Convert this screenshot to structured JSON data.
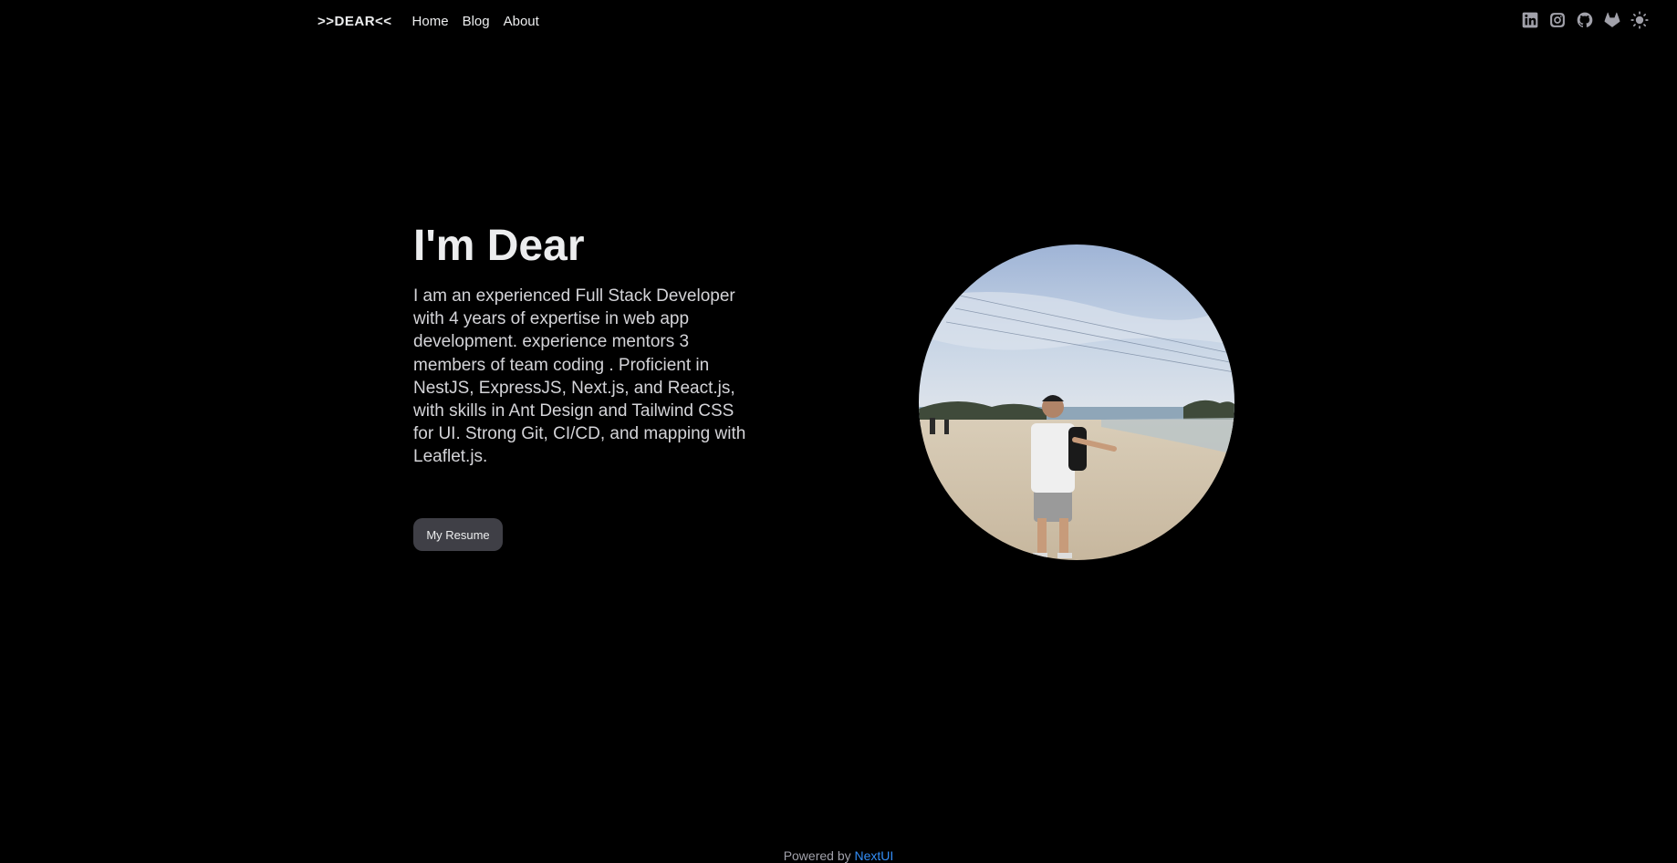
{
  "navbar": {
    "brand": ">>DEAR<<",
    "links": [
      "Home",
      "Blog",
      "About"
    ],
    "icons": [
      "linkedin-icon",
      "instagram-icon",
      "github-icon",
      "gitlab-icon",
      "theme-toggle-sun-icon"
    ]
  },
  "hero": {
    "title": "I'm Dear",
    "description": "I am an experienced Full Stack Developer with 4 years of expertise in web app development. experience mentors 3 members of team coding . Proficient in NestJS, ExpressJS, Next.js, and React.js, with skills in Ant Design and Tailwind CSS for UI. Strong Git, CI/CD, and mapping with Leaflet.js.",
    "button_label": "My Resume"
  },
  "footer": {
    "prefix": "Powered by",
    "link_label": "NextUI"
  },
  "colors": {
    "background": "#000000",
    "text": "#ECEDEE",
    "button_bg": "#3F3F46",
    "link": "#338EF7"
  }
}
